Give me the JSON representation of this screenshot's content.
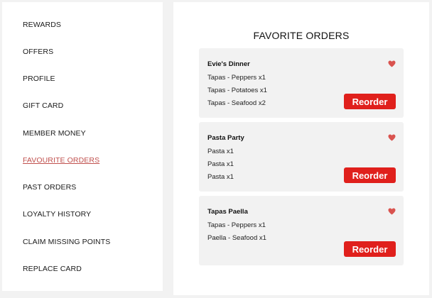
{
  "sidebar": {
    "items": [
      {
        "label": "REWARDS"
      },
      {
        "label": "OFFERS"
      },
      {
        "label": "PROFILE"
      },
      {
        "label": "GIFT CARD"
      },
      {
        "label": "MEMBER MONEY"
      },
      {
        "label": "FAVOURITE ORDERS",
        "active": true
      },
      {
        "label": "PAST ORDERS"
      },
      {
        "label": "LOYALTY HISTORY"
      },
      {
        "label": "CLAIM MISSING POINTS"
      },
      {
        "label": "REPLACE CARD"
      }
    ]
  },
  "main": {
    "title": "FAVORITE ORDERS",
    "reorder_label": "Reorder",
    "heart_icon": "heart-icon",
    "colors": {
      "accent": "#e0201c",
      "heart": "#d9534f",
      "active_link": "#c0504d"
    },
    "orders": [
      {
        "name": "Evie's Dinner",
        "lines": [
          "Tapas - Peppers x1",
          "Tapas - Potatoes x1",
          "Tapas - Seafood x2"
        ]
      },
      {
        "name": "Pasta Party",
        "lines": [
          "Pasta x1",
          "Pasta x1",
          "Pasta x1"
        ]
      },
      {
        "name": "Tapas Paella",
        "lines": [
          "Tapas - Peppers x1",
          "Paella - Seafood x1"
        ]
      }
    ]
  }
}
